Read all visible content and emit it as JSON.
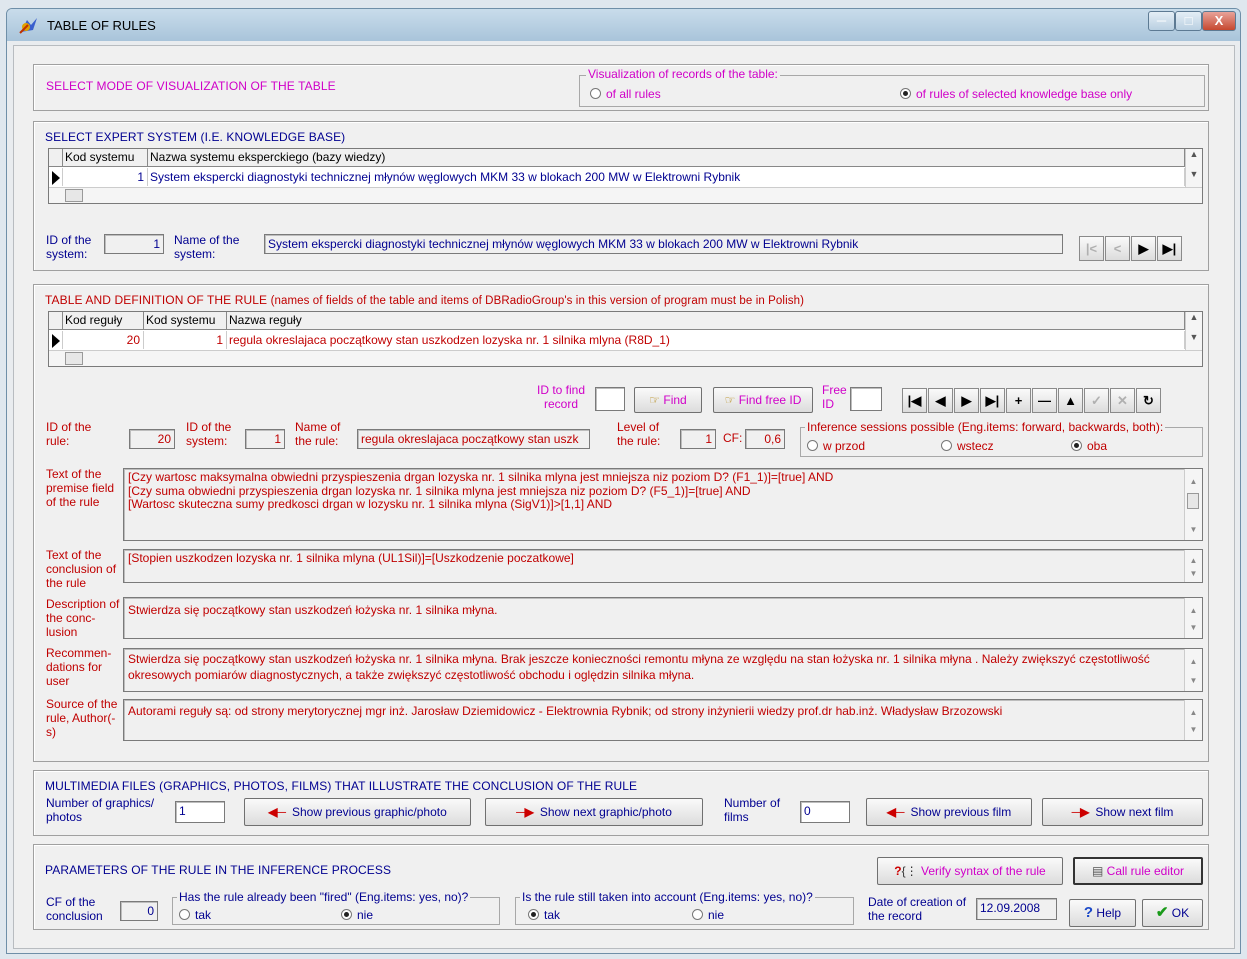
{
  "window": {
    "title": "TABLE OF RULES",
    "icon": "app-icon",
    "controls": [
      "minimize",
      "maximize",
      "close"
    ]
  },
  "mode": {
    "heading": "SELECT MODE OF VISUALIZATION OF THE TABLE",
    "group_title": "Visualization of records of the table:",
    "options": [
      {
        "label": "of all rules",
        "selected": false
      },
      {
        "label": "of rules of selected knowledge base only",
        "selected": true
      }
    ]
  },
  "expert": {
    "heading": "SELECT EXPERT SYSTEM (I.E. KNOWLEDGE BASE)",
    "columns": [
      "Kod systemu",
      "Nazwa systemu eksperckiego (bazy wiedzy)"
    ],
    "rows": [
      {
        "kod": "1",
        "nazwa": "System ekspercki diagnostyki technicznej młynów węglowych MKM 33 w blokach 200 MW w Elektrowni Rybnik"
      }
    ],
    "id_label": "ID of the system:",
    "id_value": "1",
    "name_label": "Name of the system:",
    "name_value": "System ekspercki diagnostyki technicznej młynów węglowych MKM 33 w blokach 200 MW w Elektrowni Rybnik"
  },
  "rule": {
    "heading": "TABLE AND DEFINITION OF THE RULE",
    "heading_note": "(names of fields of the table and items of DBRadioGroup's in this version of program must be in Polish)",
    "columns": [
      "Kod reguły",
      "Kod systemu",
      "Nazwa reguły"
    ],
    "rows": [
      {
        "kod": "20",
        "system": "1",
        "nazwa": "regula okreslajaca początkowy stan uszkodzen lozyska nr. 1 silnika mlyna (R8D_1)"
      }
    ],
    "find_label": "ID to find record",
    "find_value": "",
    "find_btn": "Find",
    "findfree_btn": "Find free ID",
    "free_label": "Free ID",
    "free_value": "",
    "id_label": "ID of the rule:",
    "id_value": "20",
    "sys_label": "ID of the system:",
    "sys_value": "1",
    "name_label": "Name of the rule:",
    "name_value": "regula okreslajaca początkowy stan uszk",
    "level_label": "Level of the rule:",
    "level_value": "1",
    "cf_label": "CF:",
    "cf_value": "0,6",
    "sessions_title": "Inference sessions possible (Eng.items: forward, backwards, both):",
    "sessions": [
      {
        "label": "w przod",
        "selected": false
      },
      {
        "label": "wstecz",
        "selected": false
      },
      {
        "label": "oba",
        "selected": true
      }
    ],
    "premise_label": "Text of the premise field of the rule",
    "premise_lines": [
      "[Czy wartosc maksymalna obwiedni przyspieszenia drgan lozyska nr. 1 silnika mlyna jest mniejsza niz poziom D? (F1_1)]=[true] AND",
      "[Czy suma obwiedni przyspieszenia drgan lozyska nr. 1 silnika mlyna jest mniejsza niz poziom D? (F5_1)]=[true] AND",
      "[Wartosc skuteczna sumy predkosci drgan w lozysku nr. 1 silnika mlyna (SigV1)]>[1,1] AND"
    ],
    "conclusion_label": "Text of the conclusion of the rule",
    "conclusion": "[Stopien uszkodzen lozyska nr. 1 silnika mlyna (UL1Sil)]=[Uszkodzenie poczatkowe]",
    "description_label": "Description of the conc-lusion",
    "description": "Stwierdza się początkowy stan uszkodzeń łożyska nr. 1 silnika młyna.",
    "recommend_label": "Recommen-dations for user",
    "recommend": "Stwierdza się początkowy stan uszkodzeń łożyska nr. 1 silnika młyna. Brak jeszcze konieczności remontu młyna ze względu na stan łożyska nr. 1 silnika młyna . Należy zwiększyć częstotliwość okresowych pomiarów diagnostycznych, a także zwiększyć częstotliwość obchodu i oględzin silnika młyna.",
    "source_label": "Source of the rule, Author(-s)",
    "source": "Autorami reguły są: od strony merytorycznej mgr inż. Jarosław Dziemidowicz - Elektrownia Rybnik; od strony inżynierii wiedzy prof.dr hab.inż. Władysław Brzozowski"
  },
  "multimedia": {
    "heading": "MULTIMEDIA FILES (GRAPHICS, PHOTOS, FILMS) THAT ILLUSTRATE THE CONCLUSION OF THE RULE",
    "graphics_label": "Number of graphics/ photos",
    "graphics_value": "1",
    "prev_graphic": "Show previous graphic/photo",
    "next_graphic": "Show next graphic/photo",
    "films_label": "Number of films",
    "films_value": "0",
    "prev_film": "Show previous film",
    "next_film": "Show next film"
  },
  "params": {
    "heading": "PARAMETERS OF THE RULE IN THE INFERENCE PROCESS",
    "verify_btn": "Verify syntax of the rule",
    "editor_btn": "Call rule editor",
    "cf_label": "CF of the conclusion",
    "cf_value": "0",
    "fired_title": "Has the rule already been \"fired\" (Eng.items: yes, no)?",
    "fired": [
      {
        "label": "tak",
        "selected": false
      },
      {
        "label": "nie",
        "selected": true
      }
    ],
    "taken_title": "Is the rule still taken into account (Eng.items: yes, no)?",
    "taken": [
      {
        "label": "tak",
        "selected": true
      },
      {
        "label": "nie",
        "selected": false
      }
    ],
    "date_label": "Date of creation of the record",
    "date_value": "12.09.2008",
    "help_btn": "Help",
    "ok_btn": "OK"
  },
  "colors": {
    "magenta": "#d000c8",
    "red": "#c00000",
    "blue": "#000090"
  }
}
